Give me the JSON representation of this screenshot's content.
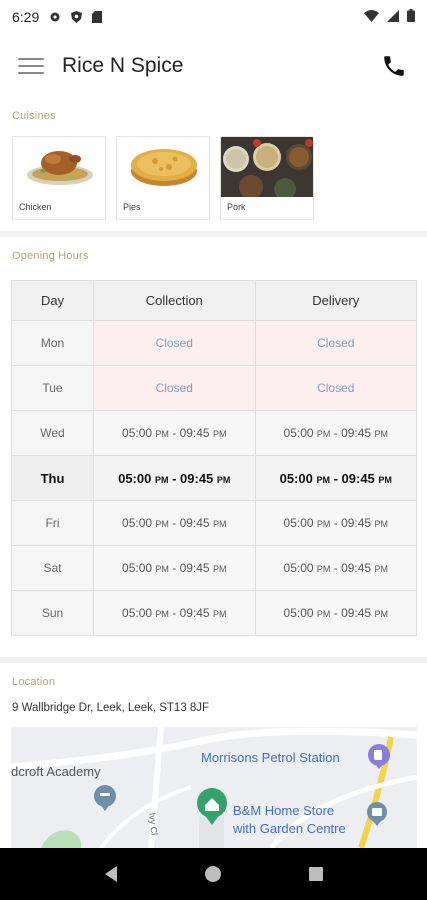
{
  "status_bar": {
    "time": "6:29"
  },
  "app_bar": {
    "title": "Rice N Spice"
  },
  "cuisines": {
    "label": "Cuisines",
    "items": [
      {
        "name": "Chicken"
      },
      {
        "name": "Pies"
      },
      {
        "name": "Pork"
      }
    ]
  },
  "hours": {
    "label": "Opening Hours",
    "headers": [
      "Day",
      "Collection",
      "Delivery"
    ],
    "rows": [
      {
        "day": "Mon",
        "collection": "Closed",
        "delivery": "Closed"
      },
      {
        "day": "Tue",
        "collection": "Closed",
        "delivery": "Closed"
      },
      {
        "day": "Wed",
        "col_start": "05:00",
        "col_start_ampm": "PM",
        "col_end": "09:45",
        "col_end_ampm": "PM",
        "del_start": "05:00",
        "del_start_ampm": "PM",
        "del_end": "09:45",
        "del_end_ampm": "PM"
      },
      {
        "day": "Thu",
        "col_start": "05:00",
        "col_start_ampm": "PM",
        "col_end": "09:45",
        "col_end_ampm": "PM",
        "del_start": "05:00",
        "del_start_ampm": "PM",
        "del_end": "09:45",
        "del_end_ampm": "PM"
      },
      {
        "day": "Fri",
        "col_start": "05:00",
        "col_start_ampm": "PM",
        "col_end": "09:45",
        "col_end_ampm": "PM",
        "del_start": "05:00",
        "del_start_ampm": "PM",
        "del_end": "09:45",
        "del_end_ampm": "PM"
      },
      {
        "day": "Sat",
        "col_start": "05:00",
        "col_start_ampm": "PM",
        "col_end": "09:45",
        "col_end_ampm": "PM",
        "del_start": "05:00",
        "del_start_ampm": "PM",
        "del_end": "09:45",
        "del_end_ampm": "PM"
      },
      {
        "day": "Sun",
        "col_start": "05:00",
        "col_start_ampm": "PM",
        "col_end": "09:45",
        "col_end_ampm": "PM",
        "del_start": "05:00",
        "del_start_ampm": "PM",
        "del_end": "09:45",
        "del_end_ampm": "PM"
      }
    ]
  },
  "location": {
    "label": "Location",
    "address": "9 Wallbridge Dr, Leek, Leek, ST13 8JF",
    "map_labels": {
      "petrol": "Morrisons Petrol Station",
      "academy": "dcroft Academy",
      "store_line1": "B&M Home Store",
      "store_line2": "with Garden Centre",
      "road": "Ivy Cl"
    }
  },
  "colors": {
    "accent_label": "#b3a374",
    "closed_bg": "#fdeef0",
    "closed_text": "#7d9ec4",
    "map_label_blue": "#3f6fd1",
    "map_pin_green": "#34a36a"
  }
}
